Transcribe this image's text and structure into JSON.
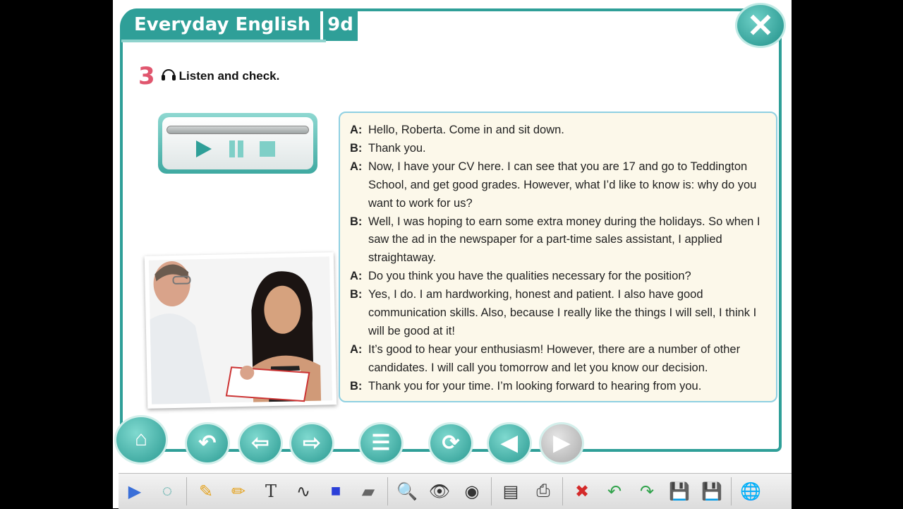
{
  "header": {
    "title": "Everyday English",
    "unit": "9d"
  },
  "exercise": {
    "number": "3",
    "instruction": "Listen and check."
  },
  "dialogue": [
    {
      "speaker": "A:",
      "text": "Hello, Roberta. Come in and sit down."
    },
    {
      "speaker": "B:",
      "text": "Thank you."
    },
    {
      "speaker": "A:",
      "text": "Now, I have your CV here. I can see that you are 17 and go to Teddington School, and get good grades. However, what I’d like to know is: why do you want to work for us?"
    },
    {
      "speaker": "B:",
      "text": "Well, I was hoping to earn some extra money during the holidays. So when I saw the ad in the newspaper for a part-time sales assistant, I applied straightaway."
    },
    {
      "speaker": "A:",
      "text": "Do you think you have the qualities necessary for the position?"
    },
    {
      "speaker": "B:",
      "text": "Yes, I do. I am hardworking, honest and patient. I also have good communication skills. Also, because I really like the things I will sell, I think I will be good at it!"
    },
    {
      "speaker": "A:",
      "text": "It’s good to hear your enthusiasm! However, there are a number of other candidates. I will call you tomorrow and let you know our decision."
    },
    {
      "speaker": "B:",
      "text": "Thank you for your time. I’m looking forward to hearing from you."
    }
  ],
  "icons": {
    "close": "✕",
    "home": "⌂",
    "back": "↶",
    "prev": "⇦",
    "next": "⇨",
    "menu": "☰",
    "refresh": "⟳",
    "page_prev": "◀",
    "page_next": "▶",
    "expand": "▶",
    "mouse": "◌",
    "pencil": "✎",
    "marker": "✏",
    "text": "T",
    "curve": "∿",
    "shape": "■",
    "eraser": "▰",
    "zoom": "🔍",
    "reveal": "👁",
    "hide": "◉",
    "board": "▤",
    "print": "⎙",
    "delete": "✖",
    "undo": "↶",
    "redo": "↷",
    "save": "💾",
    "save_as": "💾",
    "globe": "🌐"
  },
  "colors": {
    "accent": "#2f9f98",
    "exercise_number": "#e0566e",
    "dialog_bg": "#fcf8ea"
  }
}
